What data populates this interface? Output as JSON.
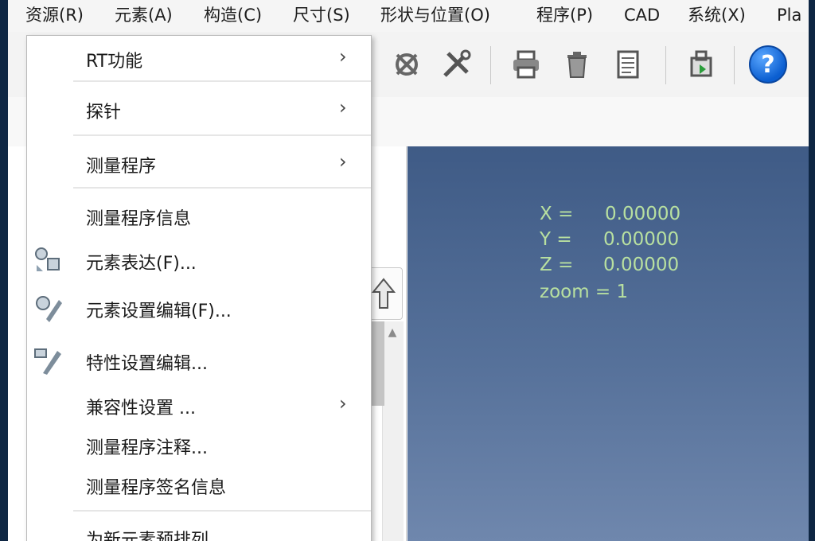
{
  "menubar": {
    "items": [
      "资源(R)",
      "元素(A)",
      "构造(C)",
      "尺寸(S)",
      "形状与位置(O)",
      "程序(P)",
      "CAD",
      "系统(X)",
      "Pla"
    ]
  },
  "toolbar": {
    "icons": [
      "tool-icon",
      "measure-icon",
      "print-icon",
      "delete-icon",
      "report-icon",
      "export-icon",
      "help-icon"
    ],
    "help_glyph": "?"
  },
  "viewport": {
    "x_label": "X =",
    "x_value": "0.00000",
    "y_label": "Y =",
    "y_value": "0.00000",
    "z_label": "Z =",
    "z_value": "0.00000",
    "zoom_text": "zoom = 1"
  },
  "dropdown": {
    "items": [
      {
        "label": "RT功能",
        "submenu": true
      },
      {
        "label": "探针",
        "submenu": true
      },
      {
        "label": "测量程序",
        "submenu": true
      },
      {
        "label": "测量程序信息",
        "submenu": false
      },
      {
        "label": "元素表达(F)...",
        "submenu": false,
        "icon": "feature-expression-icon"
      },
      {
        "label": "元素设置编辑(F)...",
        "submenu": false,
        "icon": "feature-settings-icon"
      },
      {
        "label": "特性设置编辑...",
        "submenu": false,
        "icon": "characteristic-edit-icon"
      },
      {
        "label": "兼容性设置 ...",
        "submenu": true
      },
      {
        "label": "测量程序注释...",
        "submenu": false
      },
      {
        "label": "测量程序签名信息",
        "submenu": false
      },
      {
        "label": "为新元素预排列...",
        "submenu": false
      }
    ],
    "arrow_glyph": "›"
  }
}
